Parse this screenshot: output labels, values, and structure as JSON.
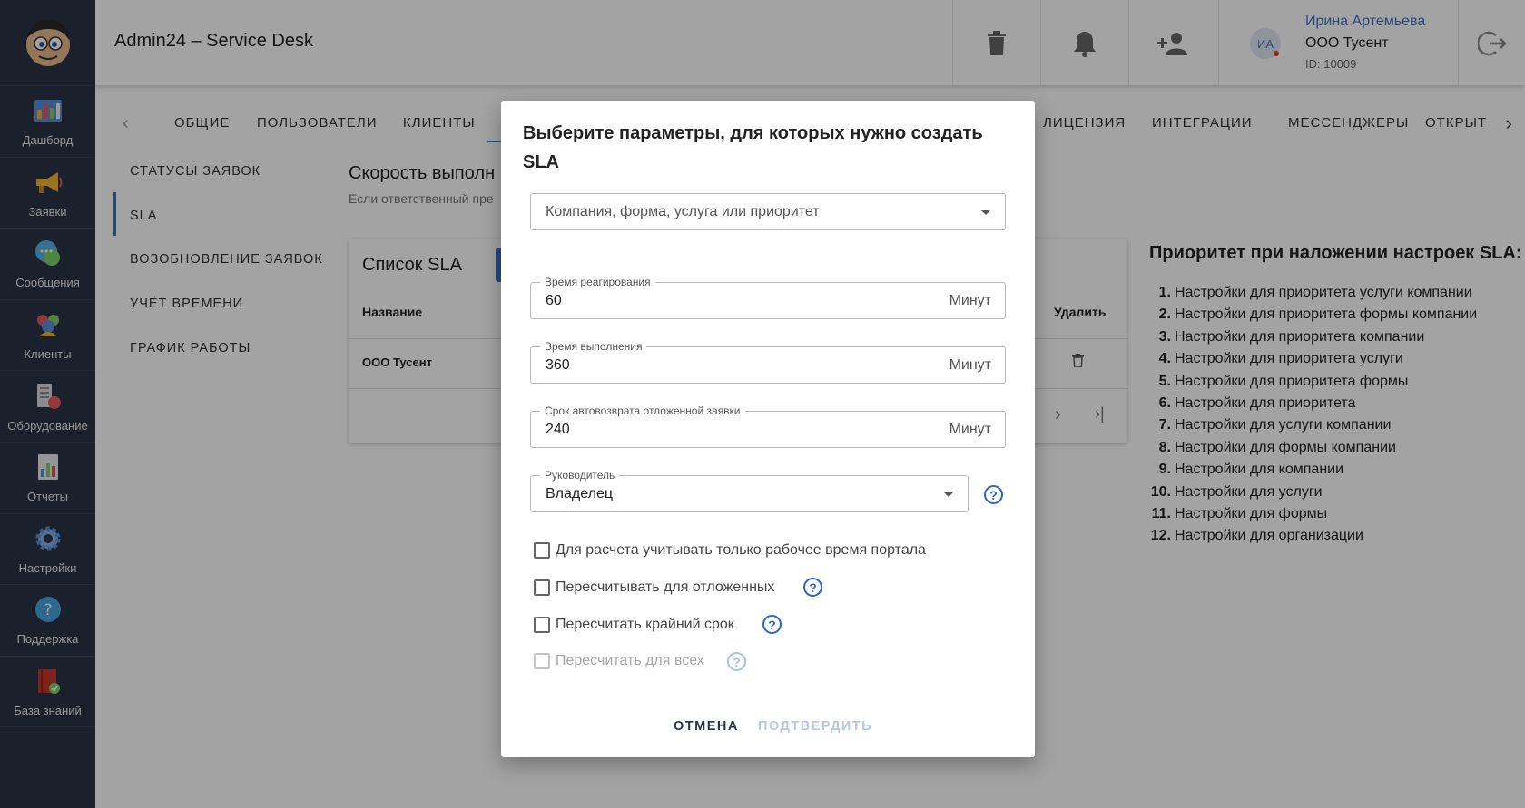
{
  "app": {
    "title": "Admin24 – Service Desk"
  },
  "sidebar": {
    "items": [
      {
        "label": "Дашборд",
        "icon": "dashboard-icon"
      },
      {
        "label": "Заявки",
        "icon": "megaphone-icon"
      },
      {
        "label": "Сообщения",
        "icon": "chat-bubble-icon"
      },
      {
        "label": "Клиенты",
        "icon": "clients-icon"
      },
      {
        "label": "Оборудование",
        "icon": "equipment-icon"
      },
      {
        "label": "Отчеты",
        "icon": "reports-icon"
      },
      {
        "label": "Настройки",
        "icon": "gear-icon"
      },
      {
        "label": "Поддержка",
        "icon": "help-icon"
      },
      {
        "label": "База знаний",
        "icon": "knowledge-book-icon"
      }
    ]
  },
  "user": {
    "initials": "ИА",
    "name": "Ирина Артемьева",
    "company": "ООО Тусент",
    "id": "ID: 10009"
  },
  "tabs": [
    "ОБЩИЕ",
    "ПОЛЬЗОВАТЕЛИ",
    "КЛИЕНТЫ",
    "ЛИЦЕНЗИЯ",
    "ИНТЕГРАЦИИ",
    "МЕССЕНДЖЕРЫ",
    "ОТКРЫТ"
  ],
  "subnav": [
    "СТАТУСЫ ЗАЯВОК",
    "SLA",
    "ВОЗОБНОВЛЕНИЕ ЗАЯВОК",
    "УЧЁТ ВРЕМЕНИ",
    "ГРАФИК РАБОТЫ"
  ],
  "section": {
    "title": "Скорость выполн",
    "subtitle": "Если ответственный пре"
  },
  "sla_list": {
    "title": "Список SLA",
    "columns": {
      "name": "Название",
      "delete": "Удалить"
    },
    "rows": [
      {
        "name": "ООО Тусент"
      }
    ]
  },
  "priority": {
    "title": "Приоритет при наложении настроек SLA:",
    "items": [
      {
        "num": "1.",
        "text": "Настройки для приоритета услуги компании"
      },
      {
        "num": "2.",
        "text": "Настройки для приоритета формы компании"
      },
      {
        "num": "3.",
        "text": "Настройки для приоритета компании"
      },
      {
        "num": "4.",
        "text": "Настройки для приоритета услуги"
      },
      {
        "num": "5.",
        "text": "Настройки для приоритета формы"
      },
      {
        "num": "6.",
        "text": "Настройки для приоритета"
      },
      {
        "num": "7.",
        "text": "Настройки для услуги компании"
      },
      {
        "num": "8.",
        "text": "Настройки для формы компании"
      },
      {
        "num": "9.",
        "text": "Настройки для компании"
      },
      {
        "num": "10.",
        "text": "Настройки для услуги"
      },
      {
        "num": "11.",
        "text": "Настройки для формы"
      },
      {
        "num": "12.",
        "text": "Настройки для организации"
      }
    ]
  },
  "dialog": {
    "title": "Выберите параметры, для которых нужно создать SLA",
    "select_placeholder": "Компания, форма, услуга или приоритет",
    "reaction": {
      "label": "Время реагирования",
      "value": "60",
      "unit": "Минут"
    },
    "completion": {
      "label": "Время выполнения",
      "value": "360",
      "unit": "Минут"
    },
    "autoreturn": {
      "label": "Срок автовозврата отложенной заявки",
      "value": "240",
      "unit": "Минут"
    },
    "manager": {
      "label": "Руководитель",
      "value": "Владелец"
    },
    "checkboxes": {
      "work_time": "Для расчета учитывать только рабочее время портала",
      "recalc_postponed": "Пересчитывать для отложенных",
      "recalc_deadline": "Пересчитать крайний срок",
      "recalc_all": "Пересчитать для всех"
    },
    "cancel": "ОТМЕНА",
    "confirm": "ПОДТВЕРДИТЬ"
  },
  "colors": {
    "sidebar": "#2b3446",
    "accent": "#3f6fc5",
    "help": "#2e63c7"
  }
}
